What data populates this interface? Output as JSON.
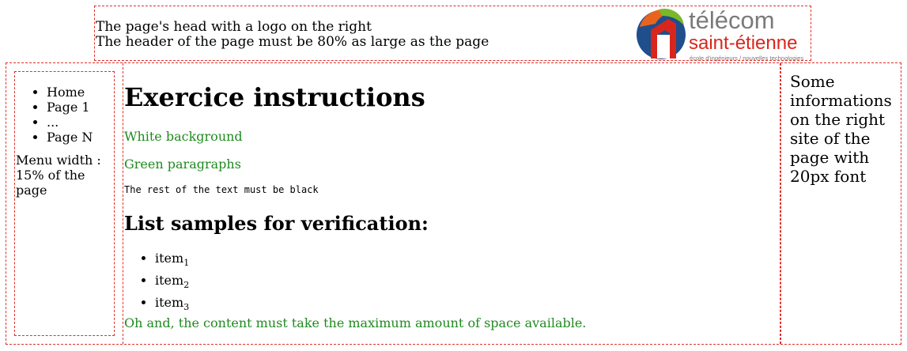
{
  "header": {
    "line1": "The page's head with a logo on the right",
    "line2": "The header of the page must be 80% as large as the page"
  },
  "logo": {
    "word1": "télécom",
    "word2": "saint-étienne",
    "tagline": "école d'ingénieurs / nouvelles technologies",
    "colors": {
      "orange": "#e8641e",
      "green": "#7ab828",
      "blue": "#1f4e8c",
      "red": "#d9261c",
      "grey": "#7a7a7a"
    }
  },
  "nav": {
    "items": [
      "Home",
      "Page 1",
      "...",
      "Page N"
    ],
    "note": "Menu width : 15% of the page"
  },
  "main": {
    "title": "Exercice instructions",
    "para1": "White background",
    "para2": "Green paragraphs",
    "mono": "The rest of the text must be black",
    "list_title": "List samples for verification:",
    "list_items": [
      {
        "text": "item",
        "sub": "1"
      },
      {
        "text": "item",
        "sub": "2"
      },
      {
        "text": "item",
        "sub": "3"
      }
    ],
    "para3": "Oh and, the content must take the maximum amount of space available."
  },
  "aside": {
    "text": "Some informations on the right site of the page with 20px font"
  },
  "colors": {
    "border": "#e0302a",
    "green_text": "#1f8a1f",
    "background": "#ffffff"
  }
}
